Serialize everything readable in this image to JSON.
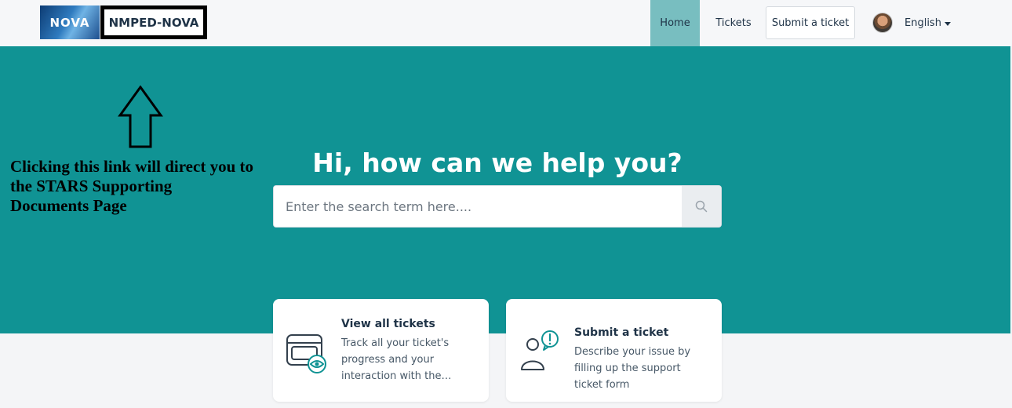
{
  "header": {
    "logo_text": "NOVA",
    "brand_link": "NMPED-NOVA",
    "nav": {
      "home": "Home",
      "tickets": "Tickets",
      "submit": "Submit a ticket"
    },
    "language": "English"
  },
  "annotation": {
    "text": "Clicking this link will direct you to the STARS Supporting Documents Page"
  },
  "hero": {
    "title": "Hi, how can we help you?",
    "search_placeholder": "Enter the search term here...."
  },
  "cards": [
    {
      "title": "View all tickets",
      "description": "Track all your ticket's progress and your interaction with the support team"
    },
    {
      "title": "Submit a ticket",
      "description": "Describe your issue by filling up the support ticket form"
    }
  ],
  "colors": {
    "hero_bg": "#109394",
    "home_tab_bg": "#78bec0",
    "accent_icon": "#109394"
  },
  "icons": {
    "search": "search-icon",
    "view_tickets": "ticket-eye-icon",
    "submit_ticket": "person-alert-icon",
    "language_caret": "caret-down-icon",
    "annotation_arrow": "up-arrow-icon"
  }
}
